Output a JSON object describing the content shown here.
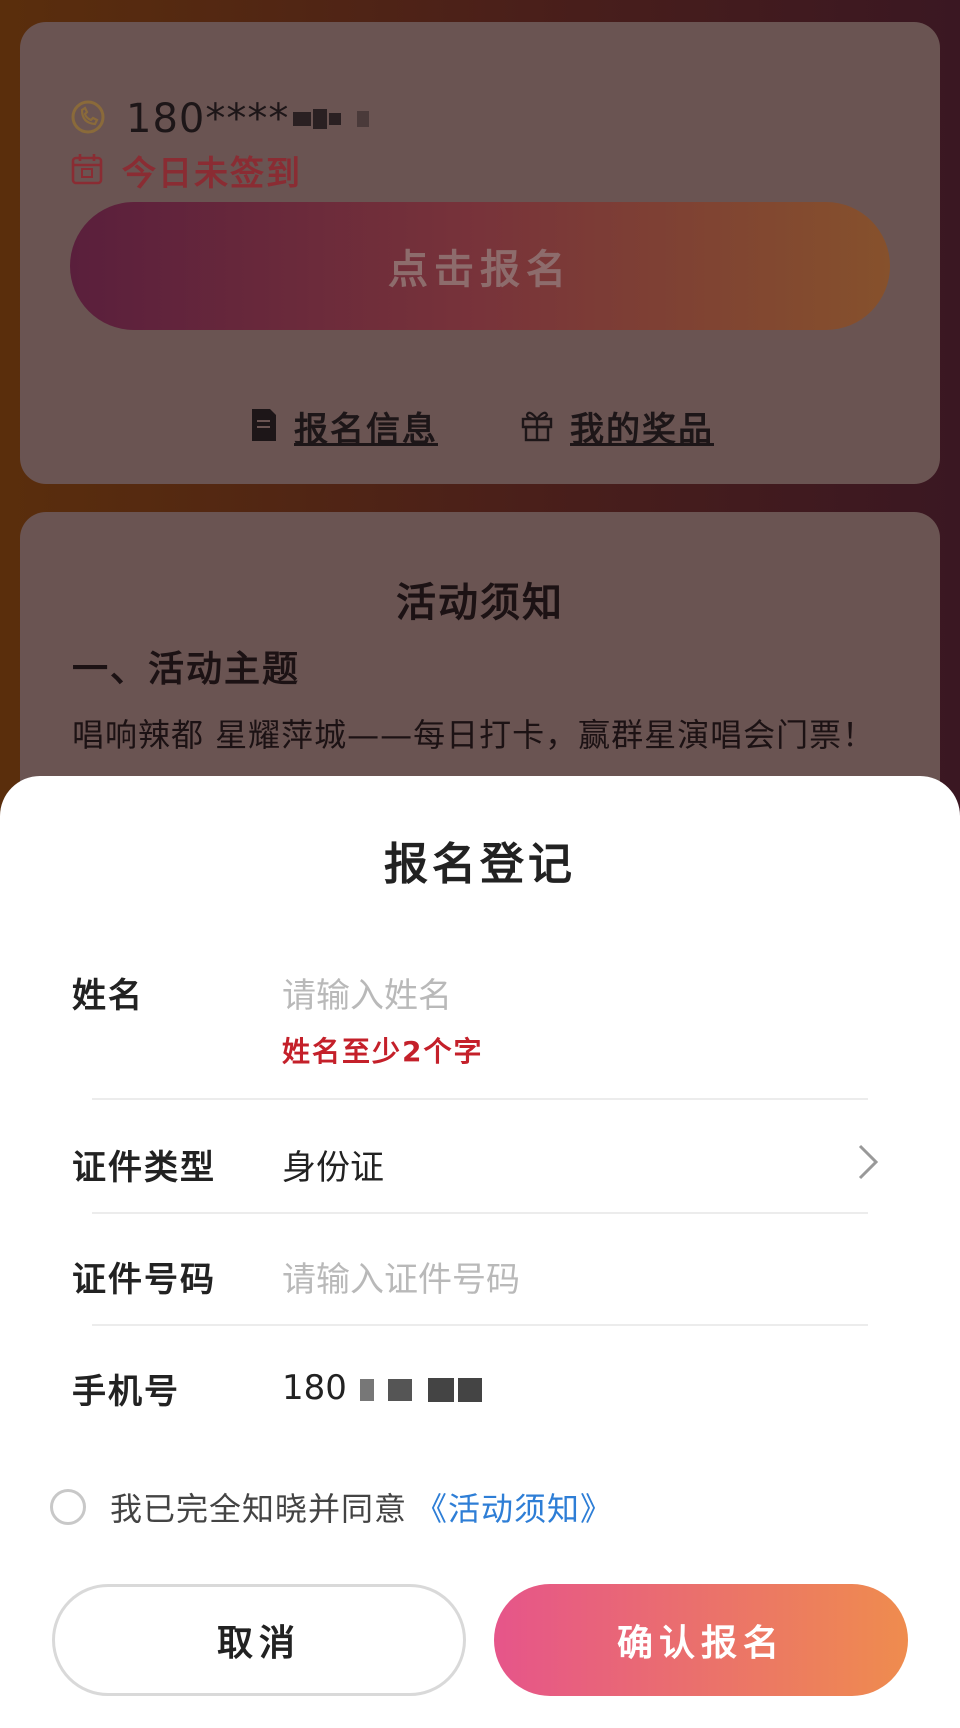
{
  "card": {
    "phone_masked": "180****",
    "signin_status": "今日未签到",
    "signup_button": "点击报名",
    "link_info": "报名信息",
    "link_prize": "我的奖品"
  },
  "notice": {
    "title": "活动须知",
    "subtitle": "一、活动主题",
    "body": "唱响辣都 星耀萍城——每日打卡，赢群星演唱会门票！"
  },
  "sheet": {
    "title": "报名登记",
    "name_label": "姓名",
    "name_placeholder": "请输入姓名",
    "name_error": "姓名至少2个字",
    "idtype_label": "证件类型",
    "idtype_value": "身份证",
    "idnum_label": "证件号码",
    "idnum_placeholder": "请输入证件号码",
    "phone_label": "手机号",
    "phone_value": "180",
    "agree_text": "我已完全知晓并同意",
    "agree_link": "《活动须知》",
    "cancel": "取消",
    "confirm": "确认报名"
  },
  "icons": {
    "phone": "phone-icon",
    "calendar": "calendar-icon",
    "document": "document-icon",
    "gift": "gift-icon",
    "chevron": "chevron-right-icon"
  },
  "colors": {
    "accent_gradient_start": "#e6558a",
    "accent_gradient_end": "#ef8c4e",
    "error": "#c4202a",
    "link": "#2e7ed6"
  }
}
